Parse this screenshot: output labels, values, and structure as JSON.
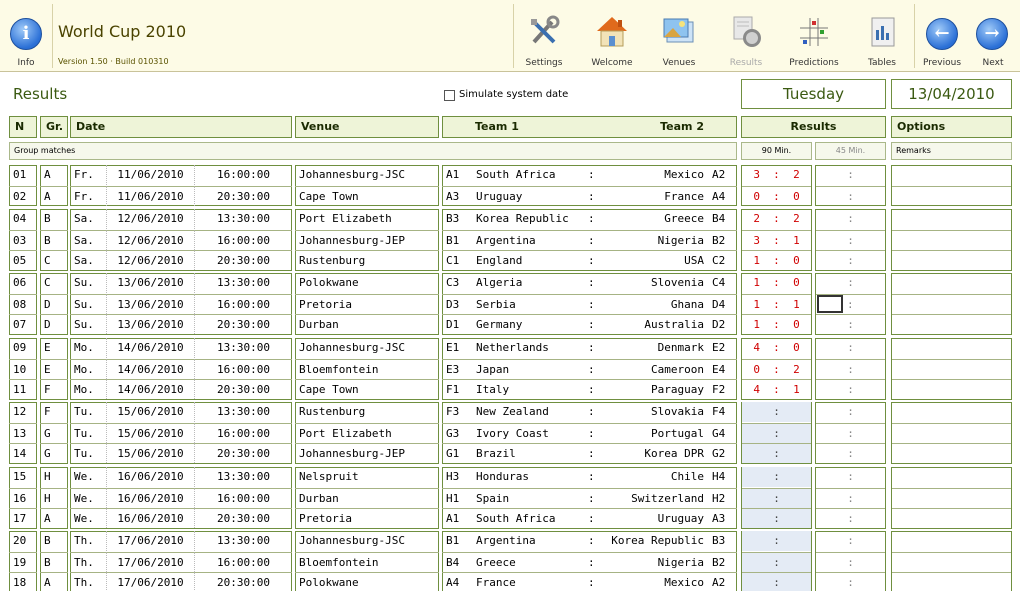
{
  "header": {
    "info_label": "Info",
    "title": "World Cup 2010",
    "version": "Version 1.50 · Build 010310",
    "buttons": [
      {
        "id": "settings",
        "label": "Settings",
        "icon": "tools-icon",
        "enabled": true
      },
      {
        "id": "welcome",
        "label": "Welcome",
        "icon": "home-icon",
        "enabled": true
      },
      {
        "id": "venues",
        "label": "Venues",
        "icon": "picture-icon",
        "enabled": true
      },
      {
        "id": "results",
        "label": "Results",
        "icon": "clock-icon",
        "enabled": false
      },
      {
        "id": "predictions",
        "label": "Predictions",
        "icon": "grid-icon",
        "enabled": true
      },
      {
        "id": "tables",
        "label": "Tables",
        "icon": "table-icon",
        "enabled": true
      },
      {
        "id": "previous",
        "label": "Previous",
        "icon": "arrow-left-icon",
        "enabled": true
      },
      {
        "id": "next",
        "label": "Next",
        "icon": "arrow-right-icon",
        "enabled": true
      }
    ]
  },
  "page": {
    "title": "Results",
    "simulate_label": "Simulate system date",
    "day": "Tuesday",
    "date": "13/04/2010"
  },
  "columns": {
    "n": "N",
    "gr": "Gr.",
    "date": "Date",
    "venue": "Venue",
    "team1": "Team 1",
    "team2": "Team 2",
    "results": "Results",
    "options": "Options",
    "group_matches": "Group matches",
    "min90": "90 Min.",
    "min45": "45 Min.",
    "remarks": "Remarks"
  },
  "colors": {
    "accent": "#3b5a12",
    "border": "#6f8f3f",
    "score": "#d00000",
    "empty": "#e4ebf5"
  },
  "groups": [
    [
      {
        "n": "01",
        "gr": "A",
        "day": "Fr.",
        "date": "11/06/2010",
        "time": "16:00:00",
        "venue": "Johannesburg-JSC",
        "c1": "A1",
        "t1": "South Africa",
        "t2": "Mexico",
        "c2": "A2",
        "s1": "3",
        "s2": "2"
      },
      {
        "n": "02",
        "gr": "A",
        "day": "Fr.",
        "date": "11/06/2010",
        "time": "20:30:00",
        "venue": "Cape Town",
        "c1": "A3",
        "t1": "Uruguay",
        "t2": "France",
        "c2": "A4",
        "s1": "0",
        "s2": "0"
      }
    ],
    [
      {
        "n": "04",
        "gr": "B",
        "day": "Sa.",
        "date": "12/06/2010",
        "time": "13:30:00",
        "venue": "Port Elizabeth",
        "c1": "B3",
        "t1": "Korea Republic",
        "t2": "Greece",
        "c2": "B4",
        "s1": "2",
        "s2": "2"
      },
      {
        "n": "03",
        "gr": "B",
        "day": "Sa.",
        "date": "12/06/2010",
        "time": "16:00:00",
        "venue": "Johannesburg-JEP",
        "c1": "B1",
        "t1": "Argentina",
        "t2": "Nigeria",
        "c2": "B2",
        "s1": "3",
        "s2": "1"
      },
      {
        "n": "05",
        "gr": "C",
        "day": "Sa.",
        "date": "12/06/2010",
        "time": "20:30:00",
        "venue": "Rustenburg",
        "c1": "C1",
        "t1": "England",
        "t2": "USA",
        "c2": "C2",
        "s1": "1",
        "s2": "0"
      }
    ],
    [
      {
        "n": "06",
        "gr": "C",
        "day": "Su.",
        "date": "13/06/2010",
        "time": "13:30:00",
        "venue": "Polokwane",
        "c1": "C3",
        "t1": "Algeria",
        "t2": "Slovenia",
        "c2": "C4",
        "s1": "1",
        "s2": "0"
      },
      {
        "n": "08",
        "gr": "D",
        "day": "Su.",
        "date": "13/06/2010",
        "time": "16:00:00",
        "venue": "Pretoria",
        "c1": "D3",
        "t1": "Serbia",
        "t2": "Ghana",
        "c2": "D4",
        "s1": "1",
        "s2": "1"
      },
      {
        "n": "07",
        "gr": "D",
        "day": "Su.",
        "date": "13/06/2010",
        "time": "20:30:00",
        "venue": "Durban",
        "c1": "D1",
        "t1": "Germany",
        "t2": "Australia",
        "c2": "D2",
        "s1": "1",
        "s2": "0"
      }
    ],
    [
      {
        "n": "09",
        "gr": "E",
        "day": "Mo.",
        "date": "14/06/2010",
        "time": "13:30:00",
        "venue": "Johannesburg-JSC",
        "c1": "E1",
        "t1": "Netherlands",
        "t2": "Denmark",
        "c2": "E2",
        "s1": "4",
        "s2": "0"
      },
      {
        "n": "10",
        "gr": "E",
        "day": "Mo.",
        "date": "14/06/2010",
        "time": "16:00:00",
        "venue": "Bloemfontein",
        "c1": "E3",
        "t1": "Japan",
        "t2": "Cameroon",
        "c2": "E4",
        "s1": "0",
        "s2": "2"
      },
      {
        "n": "11",
        "gr": "F",
        "day": "Mo.",
        "date": "14/06/2010",
        "time": "20:30:00",
        "venue": "Cape Town",
        "c1": "F1",
        "t1": "Italy",
        "t2": "Paraguay",
        "c2": "F2",
        "s1": "4",
        "s2": "1"
      }
    ],
    [
      {
        "n": "12",
        "gr": "F",
        "day": "Tu.",
        "date": "15/06/2010",
        "time": "13:30:00",
        "venue": "Rustenburg",
        "c1": "F3",
        "t1": "New Zealand",
        "t2": "Slovakia",
        "c2": "F4",
        "s1": "",
        "s2": ""
      },
      {
        "n": "13",
        "gr": "G",
        "day": "Tu.",
        "date": "15/06/2010",
        "time": "16:00:00",
        "venue": "Port Elizabeth",
        "c1": "G3",
        "t1": "Ivory Coast",
        "t2": "Portugal",
        "c2": "G4",
        "s1": "",
        "s2": ""
      },
      {
        "n": "14",
        "gr": "G",
        "day": "Tu.",
        "date": "15/06/2010",
        "time": "20:30:00",
        "venue": "Johannesburg-JEP",
        "c1": "G1",
        "t1": "Brazil",
        "t2": "Korea DPR",
        "c2": "G2",
        "s1": "",
        "s2": ""
      }
    ],
    [
      {
        "n": "15",
        "gr": "H",
        "day": "We.",
        "date": "16/06/2010",
        "time": "13:30:00",
        "venue": "Nelspruit",
        "c1": "H3",
        "t1": "Honduras",
        "t2": "Chile",
        "c2": "H4",
        "s1": "",
        "s2": ""
      },
      {
        "n": "16",
        "gr": "H",
        "day": "We.",
        "date": "16/06/2010",
        "time": "16:00:00",
        "venue": "Durban",
        "c1": "H1",
        "t1": "Spain",
        "t2": "Switzerland",
        "c2": "H2",
        "s1": "",
        "s2": ""
      },
      {
        "n": "17",
        "gr": "A",
        "day": "We.",
        "date": "16/06/2010",
        "time": "20:30:00",
        "venue": "Pretoria",
        "c1": "A1",
        "t1": "South Africa",
        "t2": "Uruguay",
        "c2": "A3",
        "s1": "",
        "s2": ""
      }
    ],
    [
      {
        "n": "20",
        "gr": "B",
        "day": "Th.",
        "date": "17/06/2010",
        "time": "13:30:00",
        "venue": "Johannesburg-JSC",
        "c1": "B1",
        "t1": "Argentina",
        "t2": "Korea Republic",
        "c2": "B3",
        "s1": "",
        "s2": ""
      },
      {
        "n": "19",
        "gr": "B",
        "day": "Th.",
        "date": "17/06/2010",
        "time": "16:00:00",
        "venue": "Bloemfontein",
        "c1": "B4",
        "t1": "Greece",
        "t2": "Nigeria",
        "c2": "B2",
        "s1": "",
        "s2": ""
      },
      {
        "n": "18",
        "gr": "A",
        "day": "Th.",
        "date": "17/06/2010",
        "time": "20:30:00",
        "venue": "Polokwane",
        "c1": "A4",
        "t1": "France",
        "t2": "Mexico",
        "c2": "A2",
        "s1": "",
        "s2": ""
      }
    ]
  ]
}
